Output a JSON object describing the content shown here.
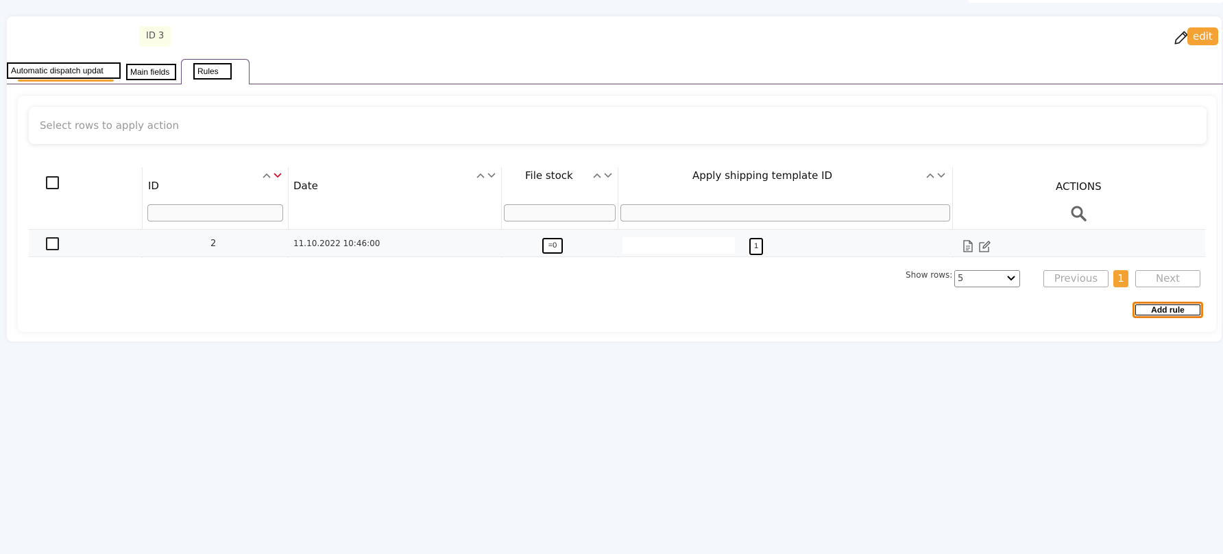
{
  "header": {
    "id_badge": "ID 3",
    "edit_label": "edit"
  },
  "tabs": [
    {
      "label": "Automatic dispatch updat"
    },
    {
      "label": "Main fields"
    },
    {
      "label": "Rules",
      "active": true
    }
  ],
  "action_bar": {
    "placeholder": "Select rows to apply action"
  },
  "table": {
    "columns": [
      {
        "label": "ID"
      },
      {
        "label": "Date"
      },
      {
        "label": "File stock"
      },
      {
        "label": "Apply shipping template ID"
      },
      {
        "label": "ACTIONS"
      }
    ],
    "rows": [
      {
        "id": "2",
        "date": "11.10.2022 10:46:00",
        "file_stock": "=0",
        "template_id": "1"
      }
    ]
  },
  "pagination": {
    "show_rows_label": "Show rows:",
    "rows_value": "5",
    "previous_label": "Previous",
    "current_page": "1",
    "next_label": "Next"
  },
  "add_rule_label": "Add rule",
  "colors": {
    "accent": "#f5a235",
    "tab_border": "#6b4a7c",
    "sort_active": "#c8102e"
  },
  "icons": [
    "pencil-icon",
    "search-icon",
    "document-icon",
    "edit-icon",
    "chevron-up-icon",
    "chevron-down-icon"
  ]
}
